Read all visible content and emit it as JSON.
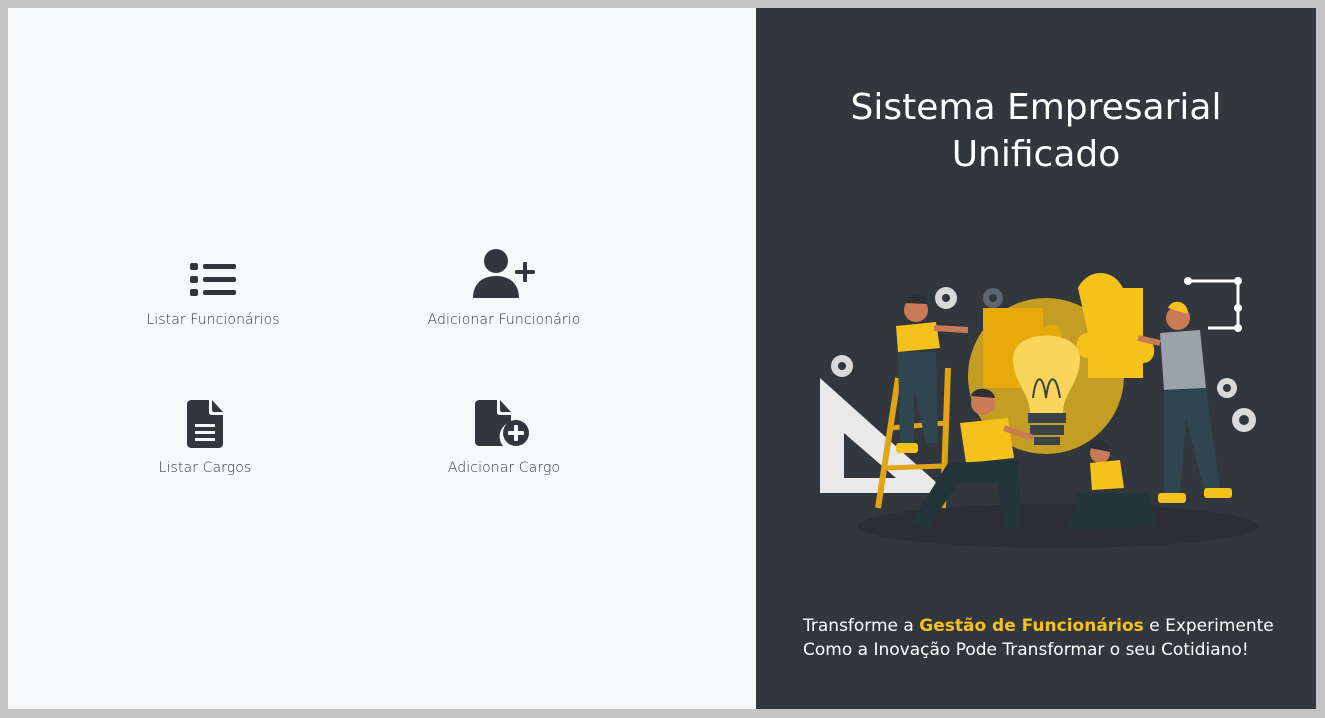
{
  "menu": {
    "list_employees": {
      "label": "Listar Funcionários",
      "icon": "list-icon"
    },
    "add_employee": {
      "label": "Adicionar Funcionário",
      "icon": "user-plus-icon"
    },
    "list_roles": {
      "label": "Listar Cargos",
      "icon": "file-icon"
    },
    "add_role": {
      "label": "Adicionar Cargo",
      "icon": "file-plus-icon"
    }
  },
  "hero": {
    "title_line1": "Sistema Empresarial",
    "title_line2": "Unificado",
    "tagline_part1": "Transforme a ",
    "tagline_highlight": "Gestão de Funcionários",
    "tagline_part2": " e Experimente",
    "tagline_line2": "Como a Inovação Pode Transformar o seu Cotidiano!"
  },
  "colors": {
    "panel_dark": "#32363d",
    "panel_light": "#f7f8fa",
    "accent": "#f5c21b",
    "icon": "#33373d"
  }
}
